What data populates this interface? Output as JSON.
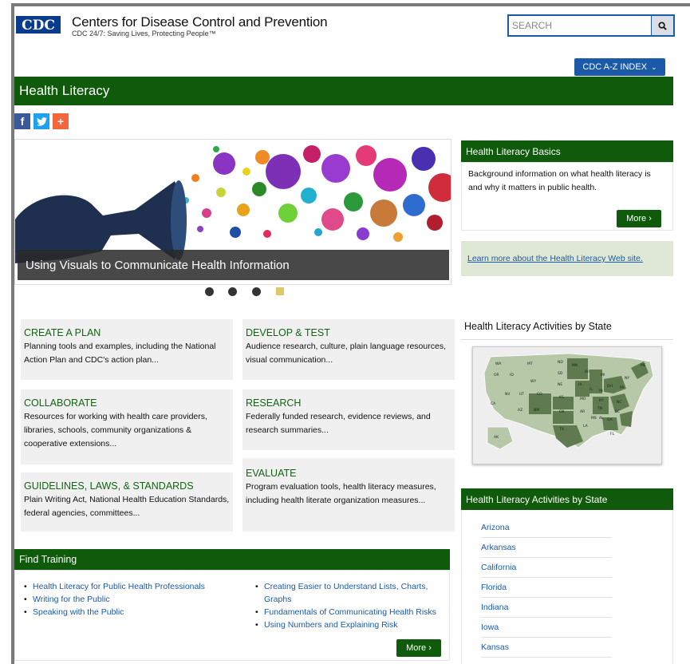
{
  "header": {
    "org_name": "Centers for Disease Control and Prevention",
    "tagline": "CDC 24/7: Saving Lives, Protecting People™",
    "search_placeholder": "SEARCH",
    "az_index": "CDC A-Z INDEX",
    "logo_text": "CDC"
  },
  "page_title": "Health Literacy",
  "social": [
    {
      "icon": "facebook-icon",
      "glyph": "f",
      "color": "#3b5998"
    },
    {
      "icon": "twitter-icon",
      "glyph": "t",
      "color": "#1da1f2"
    },
    {
      "icon": "addthis-plus-icon",
      "glyph": "+",
      "color": "#f4663b"
    }
  ],
  "carousel": {
    "caption": "Using Visuals to Communicate Health Information",
    "slide_count": 4,
    "active_index": 3
  },
  "tiles": [
    {
      "title": "CREATE A PLAN",
      "desc": "Planning tools and examples, including the National Action Plan and CDC's action plan..."
    },
    {
      "title": "DEVELOP & TEST",
      "desc": "Audience research, culture, plain language resources, visual communication..."
    },
    {
      "title": "COLLABORATE",
      "desc": "Resources for working with health care providers, libraries, schools, community organizations & cooperative extensions..."
    },
    {
      "title": "RESEARCH",
      "desc": "Federally funded research, evidence reviews, and research summaries..."
    },
    {
      "title": "GUIDELINES, LAWS, & STANDARDS",
      "desc": "Plain Writing Act, National Health Education Standards, federal agencies, committees..."
    },
    {
      "title": "EVALUATE",
      "desc": "Program evaluation tools, health literacy measures, including health literate organization measures..."
    }
  ],
  "training": {
    "title": "Find Training",
    "left_links": [
      "Health Literacy for Public Health Professionals",
      "Writing for the Public",
      "Speaking with the Public"
    ],
    "right_links": [
      "Creating Easier to Understand Lists, Charts, Graphs",
      "Fundamentals of Communicating Health Risks",
      "Using Numbers and Explaining Risk"
    ],
    "more": "More ›"
  },
  "basics": {
    "title": "Health Literacy Basics",
    "text": "Background information on what health literacy is and why it matters in public health.",
    "more": "More ›"
  },
  "learn_more": "Learn more about the Health Literacy Web site.",
  "map_title": "Health Literacy Activities by State",
  "map_labels": [
    "WA",
    "MT",
    "ND",
    "OR",
    "ID",
    "SD",
    "WY",
    "NE",
    "NV",
    "UT",
    "CO",
    "KS",
    "CA",
    "AZ",
    "NM",
    "OK",
    "TX",
    "AK",
    "MN",
    "WI",
    "MI",
    "IA",
    "IL",
    "IN",
    "OH",
    "MO",
    "KY",
    "TN",
    "AR",
    "MS",
    "AL",
    "GA",
    "SC",
    "NC",
    "LA",
    "FL",
    "NY",
    "PA",
    "ME"
  ],
  "states_list": {
    "title": "Health Literacy Activities by State",
    "items": [
      "Arizona",
      "Arkansas",
      "California",
      "Florida",
      "Indiana",
      "Iowa",
      "Kansas"
    ]
  }
}
